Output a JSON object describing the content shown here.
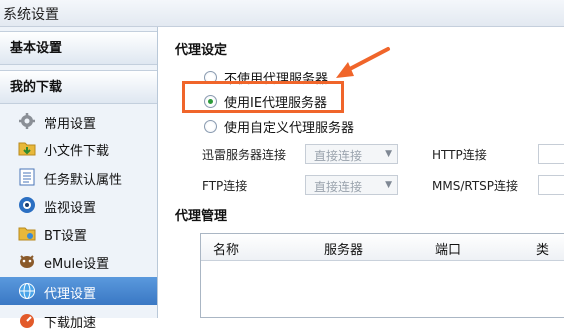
{
  "window": {
    "title": "系统设置"
  },
  "sidebar": {
    "basic_settings": "基本设置",
    "my_downloads": "我的下载",
    "items": [
      {
        "label": "常用设置",
        "icon": "gear-icon"
      },
      {
        "label": "小文件下载",
        "icon": "folder-download-icon"
      },
      {
        "label": "任务默认属性",
        "icon": "list-icon"
      },
      {
        "label": "监视设置",
        "icon": "eye-icon"
      },
      {
        "label": "BT设置",
        "icon": "bt-icon"
      },
      {
        "label": "eMule设置",
        "icon": "emule-icon"
      },
      {
        "label": "代理设置",
        "icon": "globe-icon",
        "selected": true
      },
      {
        "label": "下载加速",
        "icon": "speed-icon"
      }
    ]
  },
  "proxy_settings": {
    "title": "代理设定",
    "options": [
      {
        "label": "不使用代理服务器",
        "checked": false
      },
      {
        "label": "使用IE代理服务器",
        "checked": true
      },
      {
        "label": "使用自定义代理服务器",
        "checked": false
      }
    ],
    "thunder_server_label": "迅雷服务器连接",
    "thunder_server_value": "直接连接",
    "ftp_label": "FTP连接",
    "ftp_value": "直接连接",
    "http_label": "HTTP连接",
    "mms_label": "MMS/RTSP连接"
  },
  "proxy_management": {
    "title": "代理管理",
    "columns": [
      "名称",
      "服务器",
      "端口",
      "类"
    ]
  },
  "colors": {
    "highlight": "#f0652a",
    "selected_bg": "#3a78c4"
  }
}
